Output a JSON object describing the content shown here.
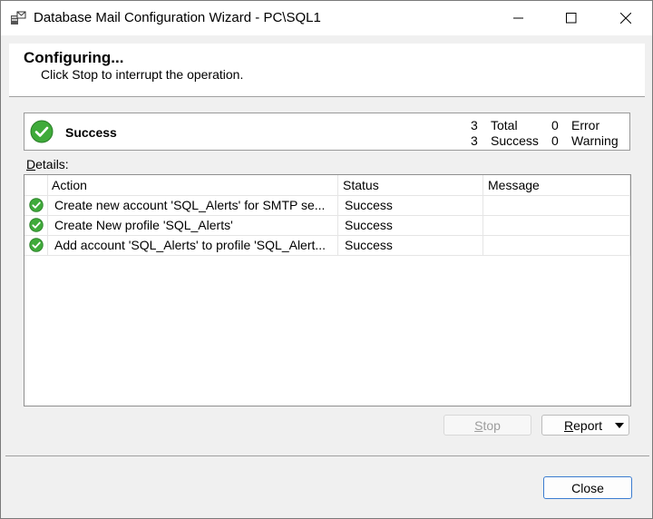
{
  "window": {
    "title": "Database Mail Configuration Wizard - PC\\SQL1",
    "controls": [
      "minimize-icon",
      "maximize-icon",
      "close-icon"
    ]
  },
  "header": {
    "title": "Configuring...",
    "subtitle": "Click Stop to interrupt the operation."
  },
  "status": {
    "icon": "success-check-icon",
    "text": "Success",
    "total_count": "3",
    "total_label": "Total",
    "success_count": "3",
    "success_label": "Success",
    "error_count": "0",
    "error_label": "Error",
    "warning_count": "0",
    "warning_label": "Warning"
  },
  "details": {
    "label_prefix": "D",
    "label_rest": "etails:",
    "columns": [
      "Action",
      "Status",
      "Message"
    ],
    "rows": [
      {
        "icon": "success-check-icon",
        "action": "Create new account 'SQL_Alerts' for SMTP se...",
        "status": "Success",
        "message": ""
      },
      {
        "icon": "success-check-icon",
        "action": "Create New profile 'SQL_Alerts'",
        "status": "Success",
        "message": ""
      },
      {
        "icon": "success-check-icon",
        "action": "Add account 'SQL_Alerts' to profile 'SQL_Alert...",
        "status": "Success",
        "message": ""
      }
    ]
  },
  "buttons": {
    "stop_prefix": "S",
    "stop_rest": "top",
    "report_prefix": "R",
    "report_rest": "eport",
    "close": "Close"
  },
  "colors": {
    "success_green": "#3faa3a",
    "accent_blue": "#3b7cd0"
  }
}
